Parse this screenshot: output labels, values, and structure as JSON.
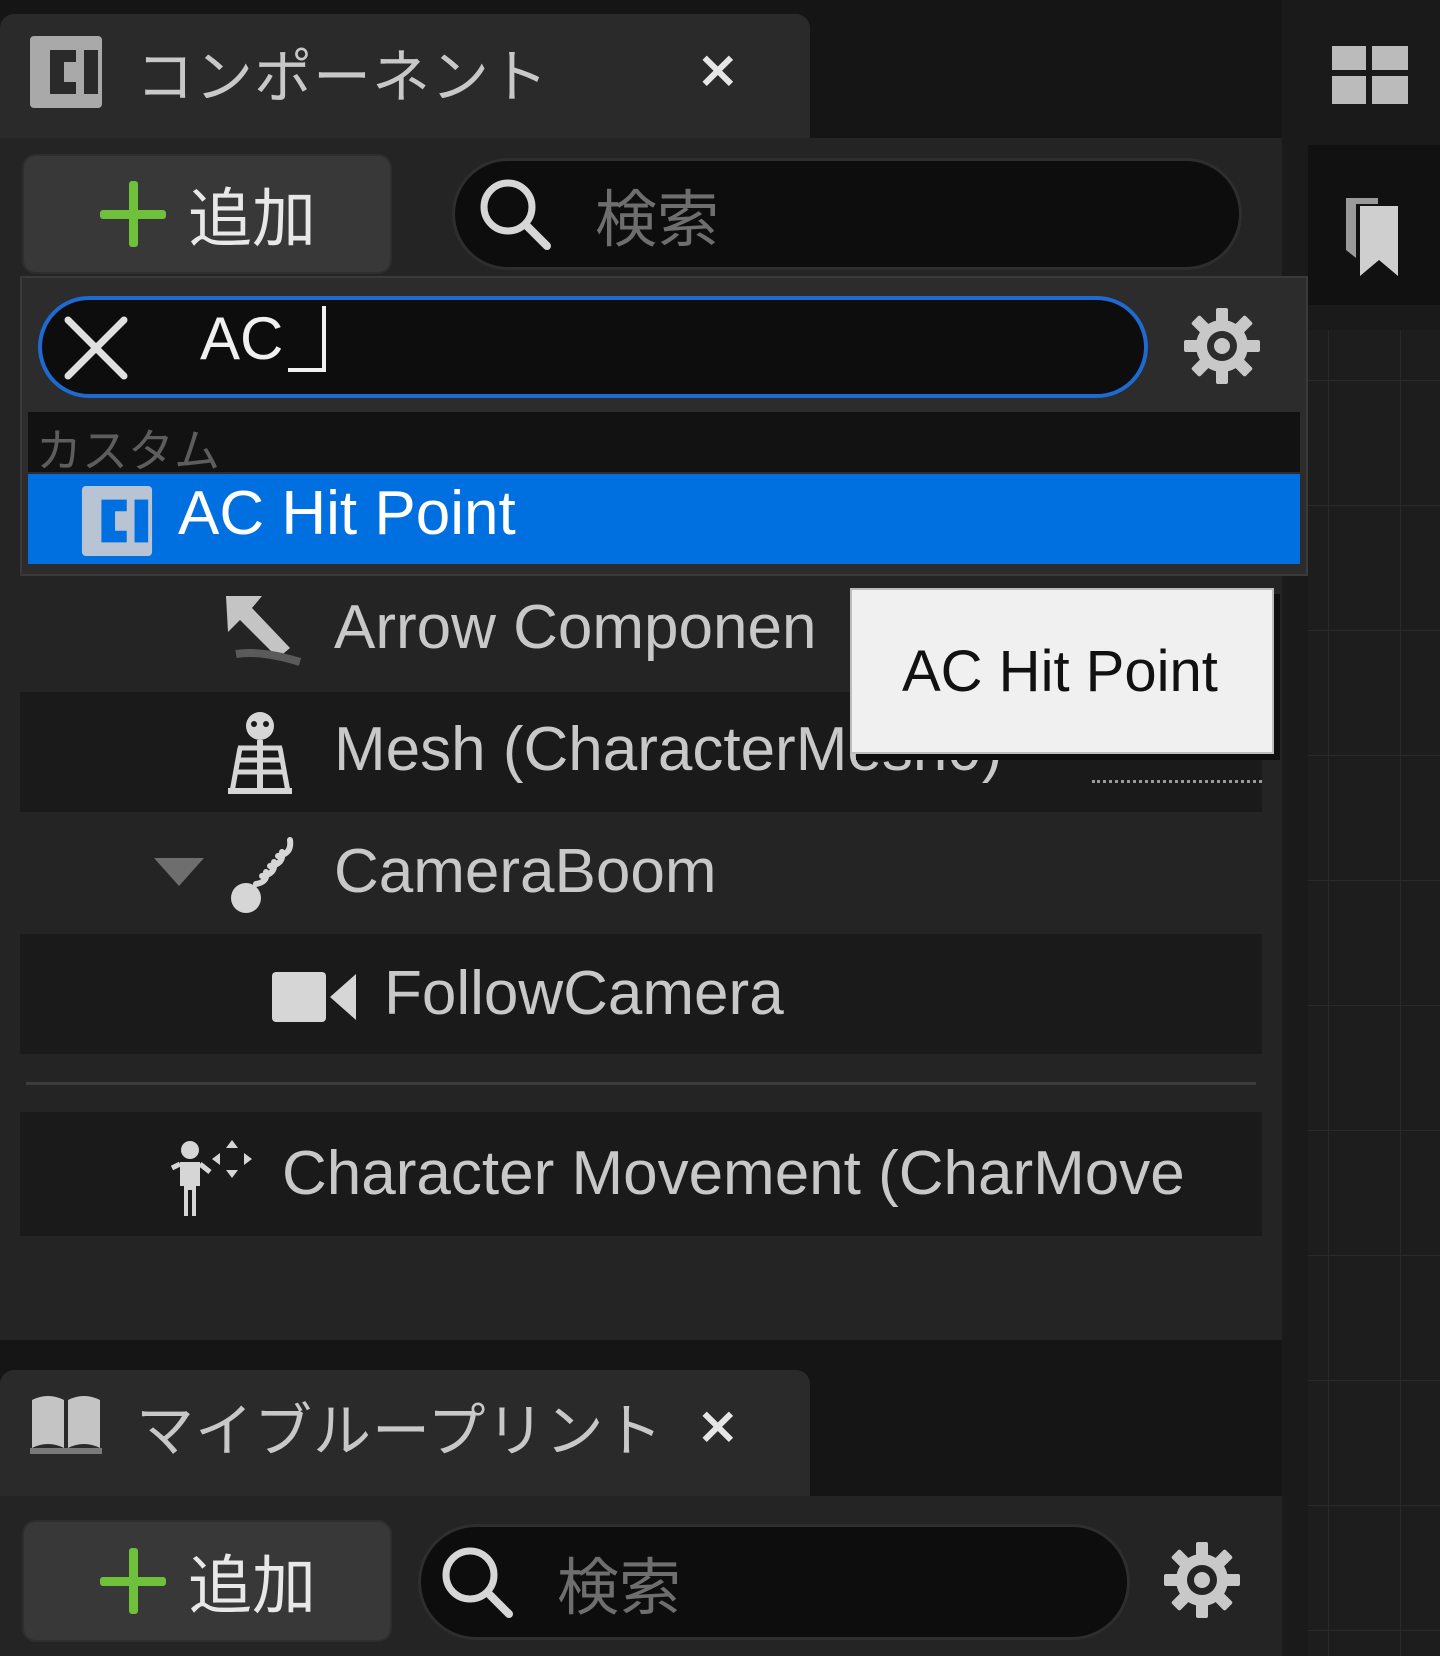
{
  "components_panel": {
    "tab_title": "コンポーネント",
    "close_glyph": "×",
    "add_button_label": "追加",
    "search_placeholder": "検索"
  },
  "add_component_popup": {
    "search_value": "AC",
    "category_label": "カスタム",
    "selected_item": "AC Hit Point",
    "tooltip": "AC Hit Point"
  },
  "component_tree": [
    {
      "label": "Arrow Componen",
      "icon": "arrow-icon"
    },
    {
      "label": "Mesh (CharacterMesh0)",
      "icon": "skeleton-icon"
    },
    {
      "label": "CameraBoom",
      "icon": "spring-arm-icon"
    },
    {
      "label": "FollowCamera",
      "icon": "camera-icon"
    },
    {
      "label": "Character Movement (CharMove",
      "icon": "character-movement-icon"
    }
  ],
  "my_blueprint_panel": {
    "tab_title": "マイブループリント",
    "close_glyph": "×",
    "add_button_label": "追加",
    "search_placeholder": "検索"
  },
  "colors": {
    "selection": "#0070e0",
    "focus_border": "#1e6ad0",
    "add_plus": "#6fc03a",
    "panel_bg": "#242424"
  }
}
